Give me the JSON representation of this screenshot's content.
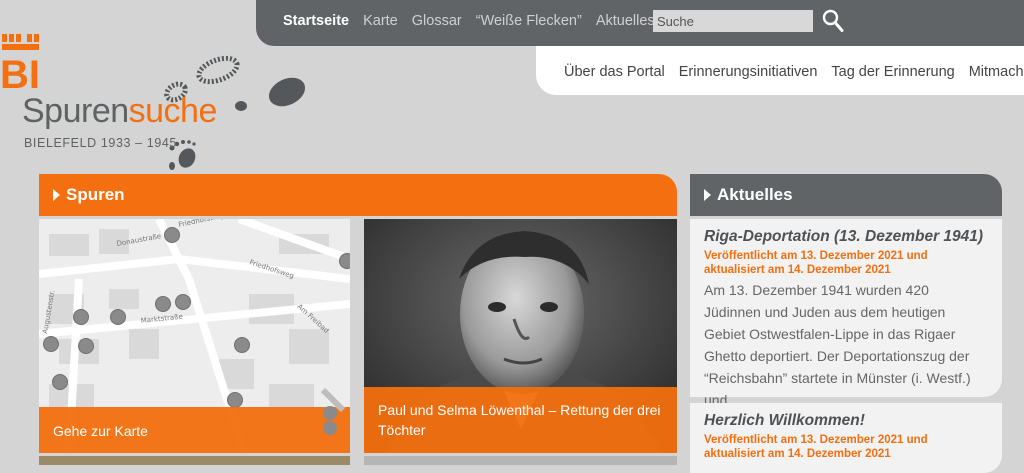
{
  "nav": {
    "items": [
      {
        "label": "Startseite",
        "active": true
      },
      {
        "label": "Karte"
      },
      {
        "label": "Glossar"
      },
      {
        "label": "“Weiße Flecken”"
      },
      {
        "label": "Aktuelles"
      }
    ],
    "search_placeholder": "Suche"
  },
  "subnav": {
    "items": [
      {
        "label": "Über das Portal"
      },
      {
        "label": "Erinnerungsinitiativen"
      },
      {
        "label": "Tag der Erinnerung"
      },
      {
        "label": "Mitmachen!"
      }
    ]
  },
  "logo": {
    "city_mark": "BI",
    "word1": "Spuren",
    "word2": "suche",
    "subtitle": "BIELEFELD 1933 – 1945"
  },
  "spuren": {
    "title": "Spuren",
    "tiles": [
      {
        "caption": "Gehe zur Karte",
        "street_labels": [
          "Donaustraße",
          "Friedhofsweg",
          "Friedhofsweg",
          "Marktstraße",
          "Am Freibad",
          "Augustenstr."
        ]
      },
      {
        "caption": "Paul und Selma Löwenthal – Rettung der drei Töchter"
      }
    ]
  },
  "aktuelles": {
    "title": "Aktuelles",
    "posts": [
      {
        "title": "Riga-Deportation (13. Dezember 1941)",
        "date": "Veröffentlicht am 13. Dezember 2021 und aktualisiert am 14. Dezember 2021",
        "excerpt": "Am 13. Dezember 1941 wurden 420 Jüdinnen und Juden aus dem heutigen Gebiet Ostwestfalen-Lippe in das Rigaer Ghetto deportiert. Der Deportationszug der “Reichsbahn” startete in Münster (i. Westf.) und"
      },
      {
        "title": "Herzlich Willkommen!",
        "date": "Veröffentlicht am 13. Dezember 2021 und aktualisiert am 14. Dezember 2021"
      }
    ]
  },
  "colors": {
    "accent": "#f36f0f",
    "nav_bg": "#616466",
    "page_bg": "#d4d4d4"
  }
}
